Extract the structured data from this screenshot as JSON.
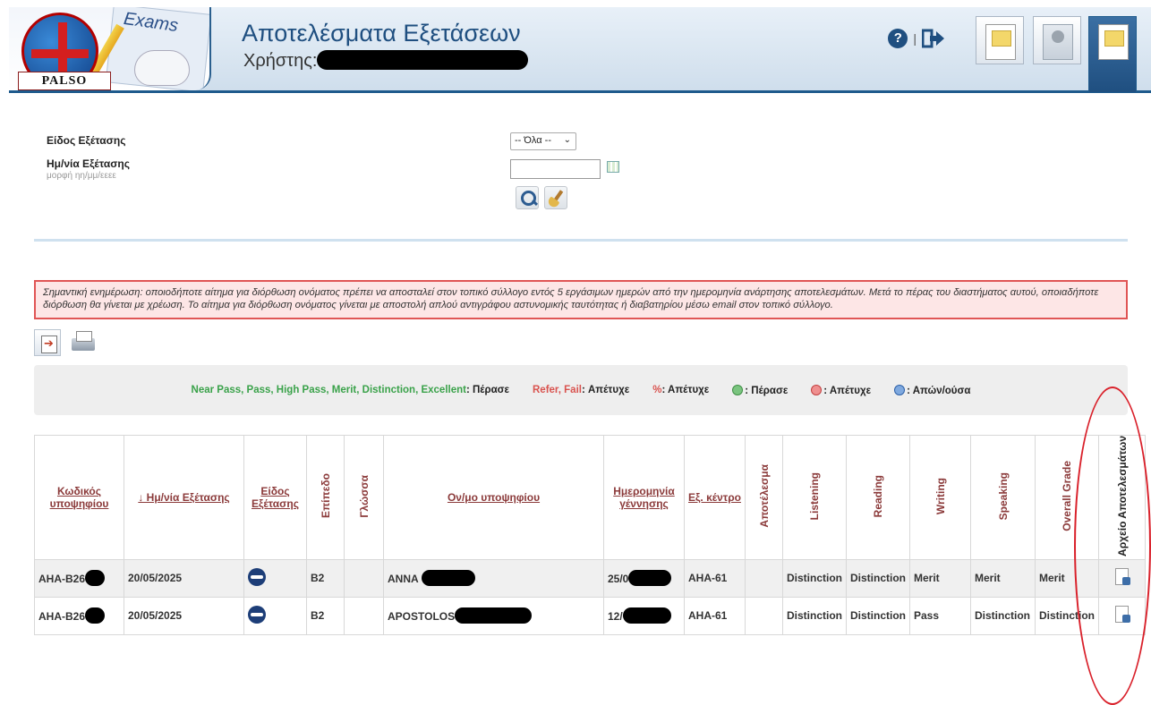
{
  "header": {
    "logo_text": "PALSO",
    "exams_text": "Exams",
    "title": "Αποτελέσματα Εξετάσεων",
    "user_label": "Χρήστης:",
    "separator": "|"
  },
  "filters": {
    "exam_type_label": "Είδος Εξέτασης",
    "exam_type_value": "-- Όλα --",
    "exam_date_label": "Ημ/νία Εξέτασης",
    "exam_date_hint": "μορφή ηη/μμ/εεεε",
    "exam_date_value": ""
  },
  "notice": "Σημαντική ενημέρωση: οποιοδήποτε αίτημα για διόρθωση ονόματος πρέπει να αποσταλεί στον τοπικό σύλλογο εντός 5 εργάσιμων ημερών από την ημερομηνία ανάρτησης αποτελεσμάτων. Μετά το πέρας του διαστήματος αυτού, οποιαδήποτε διόρθωση θα γίνεται με χρέωση. Το αίτημα για διόρθωση ονόματος γίνεται με αποστολή απλού αντιγράφου αστυνομικής ταυτότητας ή διαβατηρίου μέσω email στον τοπικό σύλλογο.",
  "legend": {
    "pass_grades": "Near Pass, Pass, High Pass, Merit, Distinction, Excellent",
    "pass_text": ": Πέρασε",
    "fail_grades": "Refer, Fail",
    "fail_text": ": Απέτυχε",
    "percent": "%",
    "percent_text": ": Απέτυχε",
    "icon_pass_text": ": Πέρασε",
    "icon_fail_text": ": Απέτυχε",
    "icon_pending_text": ": Απών/ούσα"
  },
  "table": {
    "headers": {
      "code": "Κωδικός υποψηφίου",
      "date": "↓ Ημ/νία Εξέτασης",
      "exam_type": "Είδος Εξέτασης",
      "level": "Επίπεδο",
      "language": "Γλώσσα",
      "name": "Ον/μο υποψηφίου",
      "birth": "Ημερομηνία γέννησης",
      "center": "Εξ. κέντρο",
      "result": "Αποτέλεσμα",
      "listening": "Listening",
      "reading": "Reading",
      "writing": "Writing",
      "speaking": "Speaking",
      "overall": "Overall Grade",
      "file": "Αρχείο Αποτελεσμάτων"
    },
    "rows": [
      {
        "code": "AHA-B26",
        "date": "20/05/2025",
        "level": "B2",
        "language": "",
        "name": "ANNA",
        "birth": "25/0",
        "center": "AHA-61",
        "result": "",
        "listening": "Distinction",
        "reading": "Distinction",
        "writing": "Merit",
        "speaking": "Merit",
        "overall": "Merit"
      },
      {
        "code": "AHA-B26",
        "date": "20/05/2025",
        "level": "B2",
        "language": "",
        "name": "APOSTOLOS",
        "birth": "12/",
        "center": "AHA-61",
        "result": "",
        "listening": "Distinction",
        "reading": "Distinction",
        "writing": "Pass",
        "speaking": "Distinction",
        "overall": "Distinction"
      }
    ]
  },
  "colors": {
    "brand": "#1f4f80",
    "header_link": "#8b3a3a",
    "pass_green": "#49a84e",
    "fail_red": "#d9534f",
    "notice_border": "#e05555",
    "annotation_red": "#d9202a"
  },
  "icons": {
    "help": "question-circle-icon",
    "logout": "logout-icon",
    "search": "search-icon",
    "clear": "broom-icon",
    "calendar": "calendar-icon",
    "export": "export-icon",
    "print": "printer-icon",
    "pdf": "pdf-file-icon"
  }
}
